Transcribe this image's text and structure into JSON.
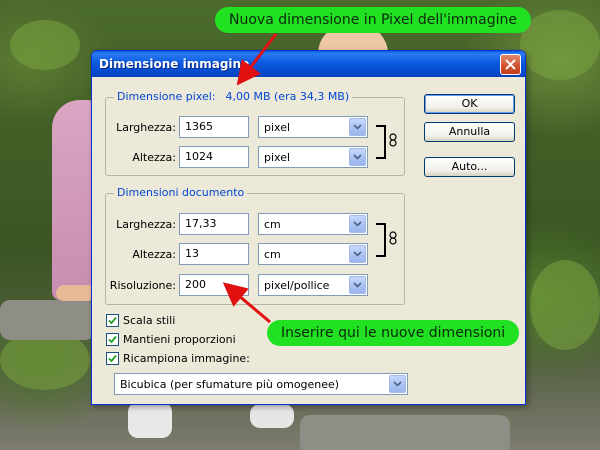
{
  "dialog": {
    "title": "Dimensione immagine",
    "close_symbol": "×"
  },
  "pixel_dims": {
    "legend": "Dimensione pixel:",
    "size_value": "4,00 MB (era 34,3 MB)",
    "width_label": "Larghezza:",
    "width_value": "1365",
    "width_unit": "pixel",
    "height_label": "Altezza:",
    "height_value": "1024",
    "height_unit": "pixel"
  },
  "doc_dims": {
    "legend": "Dimensioni documento",
    "width_label": "Larghezza:",
    "width_value": "17,33",
    "width_unit": "cm",
    "height_label": "Altezza:",
    "height_value": "13",
    "height_unit": "cm",
    "resolution_label": "Risoluzione:",
    "resolution_value": "200",
    "resolution_unit": "pixel/pollice"
  },
  "buttons": {
    "ok": "OK",
    "cancel": "Annulla",
    "auto": "Auto..."
  },
  "options": {
    "scale_styles": "Scala stili",
    "scale_styles_checked": true,
    "constrain": "Mantieni proporzioni",
    "constrain_checked": true,
    "resample": "Ricampiona immagine:",
    "resample_checked": true,
    "resample_method": "Bicubica (per sfumature più omogenee)"
  },
  "callouts": {
    "top": "Nuova dimensione in Pixel dell'immagine",
    "bottom": "Inserire qui le nuove dimensioni"
  },
  "colors": {
    "callout_bg": "#22e022",
    "arrow": "#e01010",
    "titlebar": "#0a5de0",
    "legend_text": "#0046d5"
  }
}
